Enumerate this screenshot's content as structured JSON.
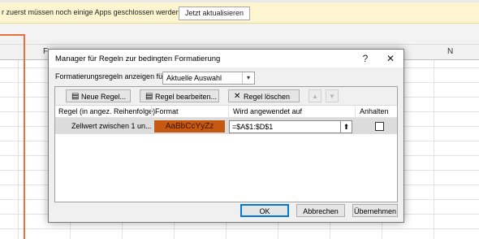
{
  "infobar": {
    "message": "r zuerst müssen noch einige Apps geschlossen werden.",
    "update_button": "Jetzt aktualisieren"
  },
  "sheet": {
    "columns": [
      "F",
      "N"
    ]
  },
  "dialog": {
    "title": "Manager für Regeln zur bedingten Formatierung",
    "help_glyph": "?",
    "close_glyph": "✕",
    "show_rules_label": "Formatierungsregeln anzeigen für:",
    "show_rules_value": "Aktuelle Auswahl",
    "toolbar": {
      "new_rule": "Neue Regel...",
      "edit_rule": "Regel bearbeiten...",
      "delete_rule": "Regel löschen"
    },
    "table": {
      "headers": [
        "Regel (in angez. Reihenfolge)",
        "Format",
        "Wird angewendet auf",
        "Anhalten"
      ],
      "rows": [
        {
          "rule": "Zellwert zwischen 1 un...",
          "format_preview": "AaBbCcYyZz",
          "format_color": "#c65911",
          "applies_to": "=$A$1:$D$1",
          "stop_if_true": false
        }
      ]
    },
    "buttons": {
      "ok": "OK",
      "cancel": "Abbrechen",
      "apply": "Übernehmen"
    }
  },
  "colors": {
    "accent_selection": "#e8703e",
    "infobar_bg": "#fdf5d0",
    "default_button_border": "#0078d7"
  }
}
